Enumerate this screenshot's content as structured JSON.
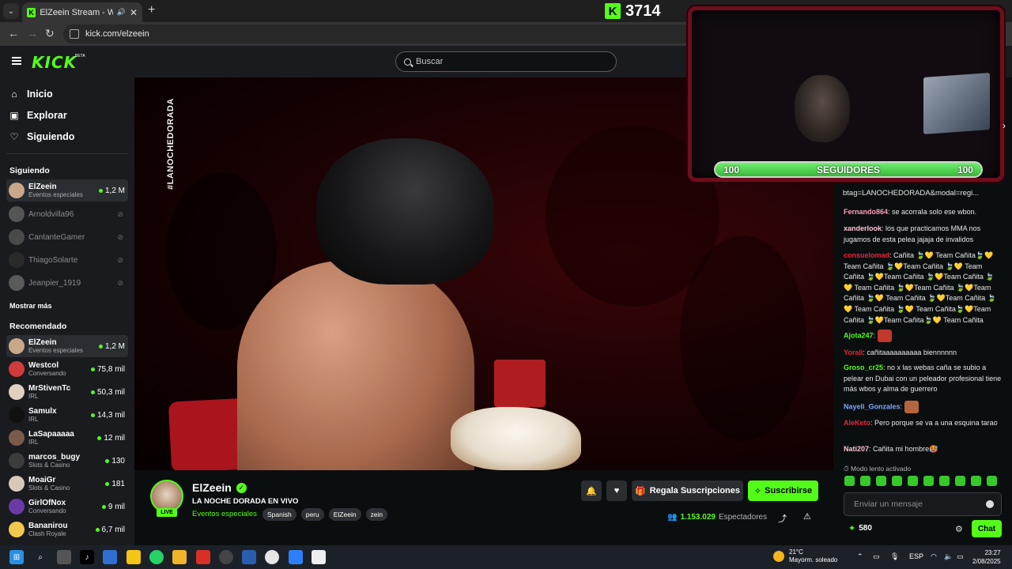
{
  "browser": {
    "tab_title": "ElZeein Stream - Watch Live",
    "url": "kick.com/elzeein"
  },
  "header": {
    "logo": "KICK",
    "logo_badge": "BETA",
    "search_placeholder": "Buscar"
  },
  "sidebar": {
    "nav": [
      {
        "label": "Inicio",
        "icon": "home-icon"
      },
      {
        "label": "Explorar",
        "icon": "compass-icon"
      },
      {
        "label": "Siguiendo",
        "icon": "heart-icon"
      }
    ],
    "following_title": "Siguiendo",
    "following": [
      {
        "name": "ElZeein",
        "category": "Eventos especiales",
        "viewers": "1,2 M",
        "live": true
      },
      {
        "name": "Arnoldvilla96",
        "live": false
      },
      {
        "name": "CantanteGamer",
        "live": false
      },
      {
        "name": "ThiagoSolarte",
        "live": false
      },
      {
        "name": "Jeanpier_1919",
        "live": false
      }
    ],
    "show_more": "Mostrar más",
    "recommended_title": "Recomendado",
    "recommended": [
      {
        "name": "ElZeein",
        "category": "Eventos especiales",
        "viewers": "1,2 M"
      },
      {
        "name": "Westcol",
        "category": "Conversando",
        "viewers": "75,8 mil"
      },
      {
        "name": "MrStivenTc",
        "category": "IRL",
        "viewers": "50,3 mil"
      },
      {
        "name": "Samulx",
        "category": "IRL",
        "viewers": "14,3 mil"
      },
      {
        "name": "LaSapaaaaa",
        "category": "IRL",
        "viewers": "12 mil"
      },
      {
        "name": "marcos_bugy",
        "category": "Slots & Casino",
        "viewers": "130"
      },
      {
        "name": "MoaiGr",
        "category": "Slots & Casino",
        "viewers": "181"
      },
      {
        "name": "GirlOfNox",
        "category": "Conversando",
        "viewers": "9 mil"
      },
      {
        "name": "Bananirou",
        "category": "Clash Royale",
        "viewers": "6,7 mil"
      }
    ]
  },
  "video": {
    "hashtag": "#LANOCHEDORADA"
  },
  "overlay": {
    "kick_count": "3714",
    "follow_left": "100",
    "follow_label": "SEGUIDORES",
    "follow_right": "100"
  },
  "channel": {
    "name": "ElZeein",
    "live_label": "LIVE",
    "title": "LA NOCHE DORADA EN VIVO",
    "category": "Eventos especiales",
    "tags": [
      "Spanish",
      "peru",
      "ElZeein",
      "zein"
    ],
    "gift_label": "Regala Suscripciones",
    "subscribe_label": "Suscribirse",
    "viewer_count": "1.153.029",
    "viewer_label": "Espectadores"
  },
  "chat": {
    "pinned_link": "btag=LANOCHEDORADA&modal=regi...",
    "messages": [
      {
        "user": "Fernando864",
        "color": "#ff9fb8",
        "text": "se acorrala solo ese wbon."
      },
      {
        "user": "xanderlook",
        "color": "#ffc4d6",
        "text": "los que practicamos MMA nos jugamos de esta pelea jajaja de invalidos"
      },
      {
        "user": "consuelomad",
        "color": "#e8263c",
        "text": "Cañita 🍃💛 Team Cañita🍃💛 Team Cañita 🍃💛Team Cañita 🍃💛 Team Cañita 🍃💛Team Cañita 🍃💛Team Cañita 🍃💛 Team Cañita 🍃💛Team Cañita 🍃💛Team Cañita 🍃💛 Team Cañita 🍃💛Team Cañita 🍃💛 Team Cañita 🍃💛 Team Cañita🍃💛Team Cañita 🍃💛Team Cañita🍃💛 Team Cañita"
      },
      {
        "user": "Ajota247",
        "color": "#53fc18",
        "text": ""
      },
      {
        "user": "Yorali",
        "color": "#e8263c",
        "text": "cañitaaaaaaaaaa biennnnnn"
      },
      {
        "user": "Groso_cr25",
        "color": "#53fc18",
        "text": "no x las webas caña se subio a pelear en Dubai con un peleador profesional tiene más wbos y alma de guerrero"
      },
      {
        "user": "Nayeli_Gonzales",
        "color": "#7aa9ff",
        "text": ""
      },
      {
        "user": "AleKeto",
        "color": "#e8263c",
        "text": "Pero porque se va a una esquina tarao"
      },
      {
        "user": "Nati207",
        "color": "#ffc4d6",
        "text": "Cañita mi hombre🥵"
      }
    ],
    "slow_mode": "Modo lento activado",
    "input_placeholder": "Enviar un mensaje",
    "kicks": "580",
    "send_label": "Chat"
  },
  "taskbar": {
    "temperature": "21°C",
    "weather": "Mayorm. soleado",
    "lang": "ESP",
    "time": "23:27",
    "date": "2/08/2025"
  },
  "colors": {
    "brand": "#53fc18",
    "background": "#0b0e0f",
    "panel": "#191b1f"
  }
}
